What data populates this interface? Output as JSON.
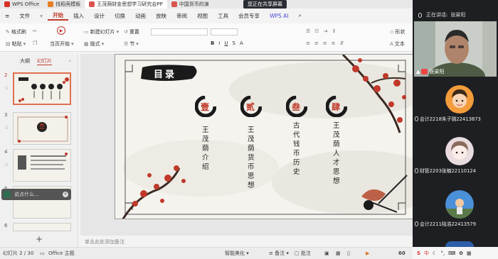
{
  "titlebar": {
    "tabs": [
      {
        "label": "WPS Office"
      },
      {
        "label": "找稻壳模板"
      },
      {
        "label": "王茂荫财金思想学习研究会PP"
      },
      {
        "label": "中国货币的演"
      }
    ],
    "share_status": "您正在共享屏幕"
  },
  "menu": {
    "file": "文件",
    "items": [
      "开始",
      "插入",
      "设计",
      "切换",
      "动画",
      "放映",
      "审阅",
      "视图",
      "工具",
      "会员专享"
    ],
    "ai": "WPS AI"
  },
  "ribbon": {
    "format_painter": "格式刷",
    "paste": "粘贴",
    "current_start": "当页开始",
    "new_slide": "新建幻灯片",
    "layout": "版式",
    "reset": "重置",
    "section": "节",
    "shape": "形状",
    "textbox": "文本"
  },
  "leftpanel": {
    "tab_outline": "大纲",
    "tab_slides": "幻灯片",
    "slide_numbers": [
      "2",
      "3",
      "4",
      "5",
      "6"
    ],
    "thumb3_char": "壹",
    "floater_placeholder": "说点什么..."
  },
  "slide": {
    "title": "目录",
    "items": [
      {
        "numeral": "壹",
        "text": "王茂荫介绍"
      },
      {
        "numeral": "贰",
        "text": "王茂荫货币思想"
      },
      {
        "numeral": "叁",
        "text": "古代钱币历史"
      },
      {
        "numeral": "肆",
        "text": "王茂荫人才思想"
      }
    ]
  },
  "notes": {
    "placeholder": "单击此处添加备注"
  },
  "statusbar": {
    "slide_counter": "幻灯片 2 / 30",
    "theme": "Office 主题",
    "smart_beautify": "智能美化",
    "notes": "备注",
    "comments": "批注",
    "zoom": "60"
  },
  "meeting": {
    "speaking_label": "正在讲话:",
    "speaker_name": "张粱阳",
    "camera_name": "张粱阳",
    "participants": [
      {
        "name": "会计2218朱子璐22413873"
      },
      {
        "name": "财管2203张楠22110124"
      },
      {
        "name": "会计2211陆浩22413579"
      }
    ]
  },
  "tray": {
    "ime": "中"
  },
  "colors": {
    "accent": "#c0392b",
    "meeting_bg": "#1e1f22",
    "ink": "#1a1a1a"
  }
}
